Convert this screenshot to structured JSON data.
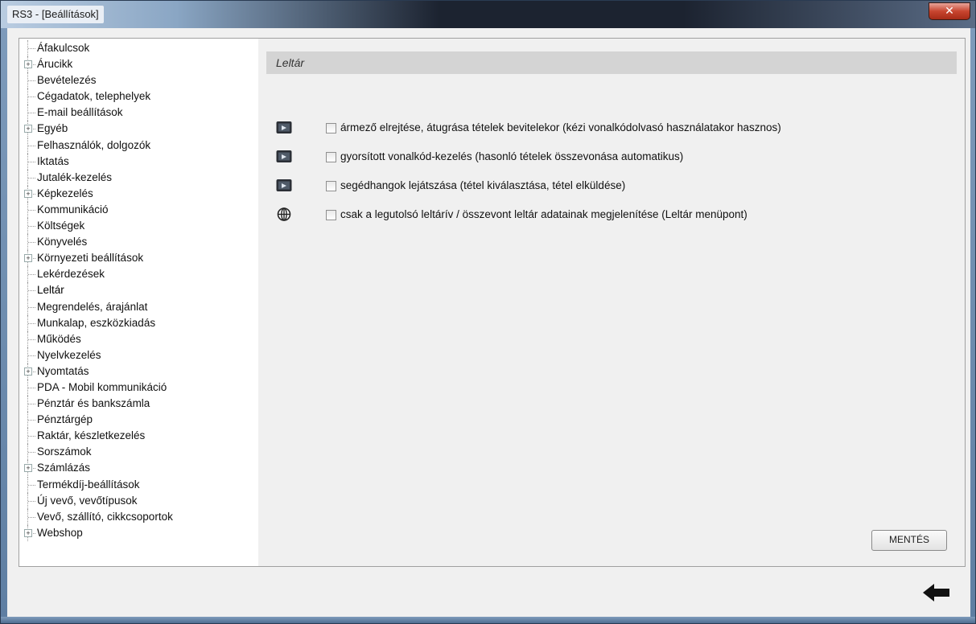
{
  "window": {
    "title": "RS3 - [Beállítások]",
    "close_label": "✕"
  },
  "tree": {
    "items": [
      {
        "label": "Áfakulcsok",
        "expandable": false
      },
      {
        "label": "Árucikk",
        "expandable": true
      },
      {
        "label": "Bevételezés",
        "expandable": false
      },
      {
        "label": "Cégadatok, telephelyek",
        "expandable": false
      },
      {
        "label": "E-mail beállítások",
        "expandable": false
      },
      {
        "label": "Egyéb",
        "expandable": true
      },
      {
        "label": "Felhasználók, dolgozók",
        "expandable": false
      },
      {
        "label": "Iktatás",
        "expandable": false
      },
      {
        "label": "Jutalék-kezelés",
        "expandable": false
      },
      {
        "label": "Képkezelés",
        "expandable": true
      },
      {
        "label": "Kommunikáció",
        "expandable": false
      },
      {
        "label": "Költségek",
        "expandable": false
      },
      {
        "label": "Könyvelés",
        "expandable": false
      },
      {
        "label": "Környezeti beállítások",
        "expandable": true
      },
      {
        "label": "Lekérdezések",
        "expandable": false
      },
      {
        "label": "Leltár",
        "expandable": false,
        "selected": true
      },
      {
        "label": "Megrendelés, árajánlat",
        "expandable": false
      },
      {
        "label": "Munkalap, eszközkiadás",
        "expandable": false
      },
      {
        "label": "Működés",
        "expandable": false
      },
      {
        "label": "Nyelvkezelés",
        "expandable": false
      },
      {
        "label": "Nyomtatás",
        "expandable": true
      },
      {
        "label": "PDA - Mobil kommunikáció",
        "expandable": false
      },
      {
        "label": "Pénztár és bankszámla",
        "expandable": false
      },
      {
        "label": "Pénztárgép",
        "expandable": false
      },
      {
        "label": "Raktár, készletkezelés",
        "expandable": false
      },
      {
        "label": "Sorszámok",
        "expandable": false
      },
      {
        "label": "Számlázás",
        "expandable": true
      },
      {
        "label": "Termékdíj-beállítások",
        "expandable": false
      },
      {
        "label": "Új vevő, vevőtípusok",
        "expandable": false
      },
      {
        "label": "Vevő, szállító, cikkcsoportok",
        "expandable": false
      },
      {
        "label": "Webshop",
        "expandable": true
      }
    ]
  },
  "content": {
    "section_title": "Leltár",
    "options": [
      {
        "icon": "monitor-icon",
        "checked": false,
        "label": "ármező elrejtése, átugrása tételek bevitelekor (kézi vonalkódolvasó használatakor hasznos)"
      },
      {
        "icon": "monitor-icon",
        "checked": false,
        "label": "gyorsított vonalkód-kezelés (hasonló tételek összevonása automatikus)"
      },
      {
        "icon": "monitor-icon",
        "checked": false,
        "label": "segédhangok lejátszása (tétel kiválasztása, tétel elküldése)"
      },
      {
        "icon": "globe-icon",
        "checked": false,
        "label": "csak a legutolsó leltárív / összevont leltár adatainak megjelenítése (Leltár menüpont)"
      }
    ],
    "save_label": "MENTÉS"
  },
  "footer": {
    "back_icon": "back-arrow-icon"
  }
}
